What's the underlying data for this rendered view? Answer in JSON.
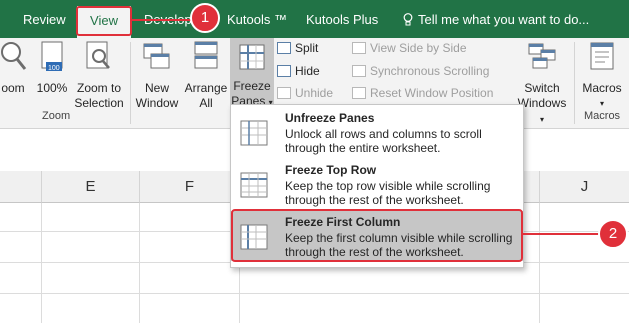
{
  "tabs": [
    {
      "label": "Review",
      "active": false
    },
    {
      "label": "View",
      "active": true
    },
    {
      "label": "Developer",
      "active": false
    },
    {
      "label": "Kutools ™",
      "active": false
    },
    {
      "label": "Kutools Plus",
      "active": false
    }
  ],
  "tell_me": "Tell me what you want to do...",
  "ribbon": {
    "zoom_group": {
      "label": "Zoom",
      "zoom": "oom",
      "hundred": "100%",
      "zoom_selection": [
        "Zoom to",
        "Selection"
      ]
    },
    "window_group": {
      "new_window": [
        "New",
        "Window"
      ],
      "arrange_all": [
        "Arrange",
        "All"
      ],
      "freeze_panes": [
        "Freeze",
        "Panes"
      ],
      "split": "Split",
      "hide": "Hide",
      "unhide": "Unhide",
      "view_side_by_side": "View Side by Side",
      "synchronous_scrolling": "Synchronous Scrolling",
      "reset_window_position": "Reset Window Position",
      "switch_windows": [
        "Switch",
        "Windows"
      ]
    },
    "macros_group": {
      "label": "Macros",
      "macros": "Macros"
    }
  },
  "columns": [
    "E",
    "F",
    "J"
  ],
  "menu": [
    {
      "title": "Unfreeze Panes",
      "desc": "Unlock all rows and columns to scroll through the entire worksheet.",
      "selected": false
    },
    {
      "title": "Freeze Top Row",
      "desc": "Keep the top row visible while scrolling through the rest of the worksheet.",
      "selected": false
    },
    {
      "title": "Freeze First Column",
      "desc": "Keep the first column visible while scrolling through the rest of the worksheet.",
      "selected": true
    }
  ],
  "callouts": [
    "1",
    "2"
  ],
  "colors": {
    "ribbon_green": "#217346",
    "callout_red": "#e0303a",
    "selected_bg": "#c6c6c6"
  }
}
